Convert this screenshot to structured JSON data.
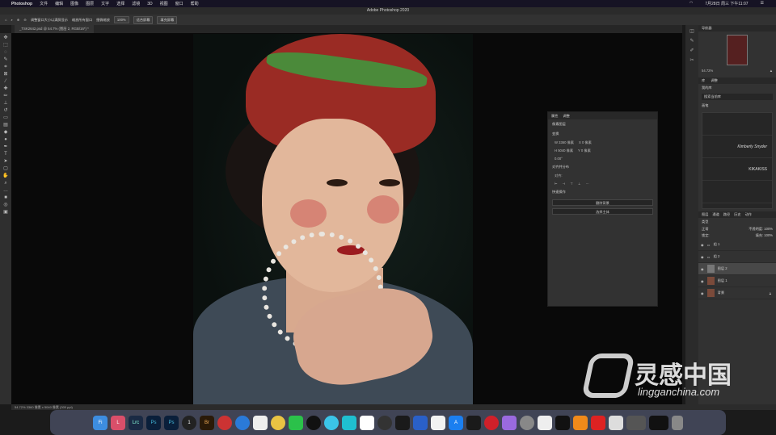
{
  "menubar": {
    "items": [
      "Photoshop",
      "文件",
      "编辑",
      "图像",
      "图层",
      "文字",
      "选择",
      "滤镜",
      "3D",
      "视图",
      "窗口",
      "帮助"
    ],
    "right": [
      "7月28日 周三 下午11:07"
    ]
  },
  "titlebar": {
    "title": "Adobe Photoshop 2020"
  },
  "options": {
    "items": [
      "调整窗口大小以满屏显示",
      "缩放所有窗口",
      "细微缩放",
      "100%",
      "适合屏幕",
      "填充屏幕"
    ]
  },
  "document_tab": {
    "label": "_TSK2642.psd @ 54.7% (图层 2, RGB/16*) *"
  },
  "properties": {
    "tabs": [
      "属性",
      "调整"
    ],
    "pixel_layer": "像素图层",
    "transform_title": "变换",
    "w": "W  3360 像素",
    "x": "X  0 像素",
    "h": "H  5040 像素",
    "y": "Y  0 像素",
    "angle": "0.00°",
    "align_title": "对齐并分布",
    "align_label": "对齐:",
    "quick_title": "快速操作",
    "btn1": "删除背景",
    "btn2": "选择主体"
  },
  "navigator": {
    "tab": "导航器",
    "zoom": "54.72%"
  },
  "brushes": {
    "tabs": [
      "库",
      "调整"
    ],
    "library": "我的库",
    "search": "搜索当前库",
    "group": "画笔",
    "items": [
      "",
      "Kimberly Snyder",
      "KIKAKISS",
      ""
    ]
  },
  "layers": {
    "tabs": [
      "图层",
      "通道",
      "路径",
      "历史",
      "动作"
    ],
    "kind": "类型",
    "blend": "正常",
    "opacity": "不透明度: 100%",
    "fill": "填充: 100%",
    "lock": "锁定:",
    "list": [
      {
        "name": "组 1",
        "active": false
      },
      {
        "name": "组 2",
        "active": false
      },
      {
        "name": "图层 2",
        "active": true
      },
      {
        "name": "图层 1",
        "active": false
      },
      {
        "name": "背景",
        "active": false
      }
    ]
  },
  "status": {
    "text": "54.72%   3360 像素 x 5040 像素 (300 ppi)"
  },
  "dock": {
    "apps": [
      "Fi",
      "L",
      "Lrc",
      "Ps",
      "Ps",
      "1",
      "Br",
      "",
      "e",
      "",
      "",
      "",
      "",
      "",
      "",
      "",
      "",
      "",
      "",
      "",
      "",
      "",
      "",
      "A",
      "",
      "",
      "",
      "",
      "",
      "",
      "",
      "",
      "",
      ""
    ]
  },
  "watermark": {
    "title": "灵感中国",
    "url": "lingganchina.com"
  }
}
